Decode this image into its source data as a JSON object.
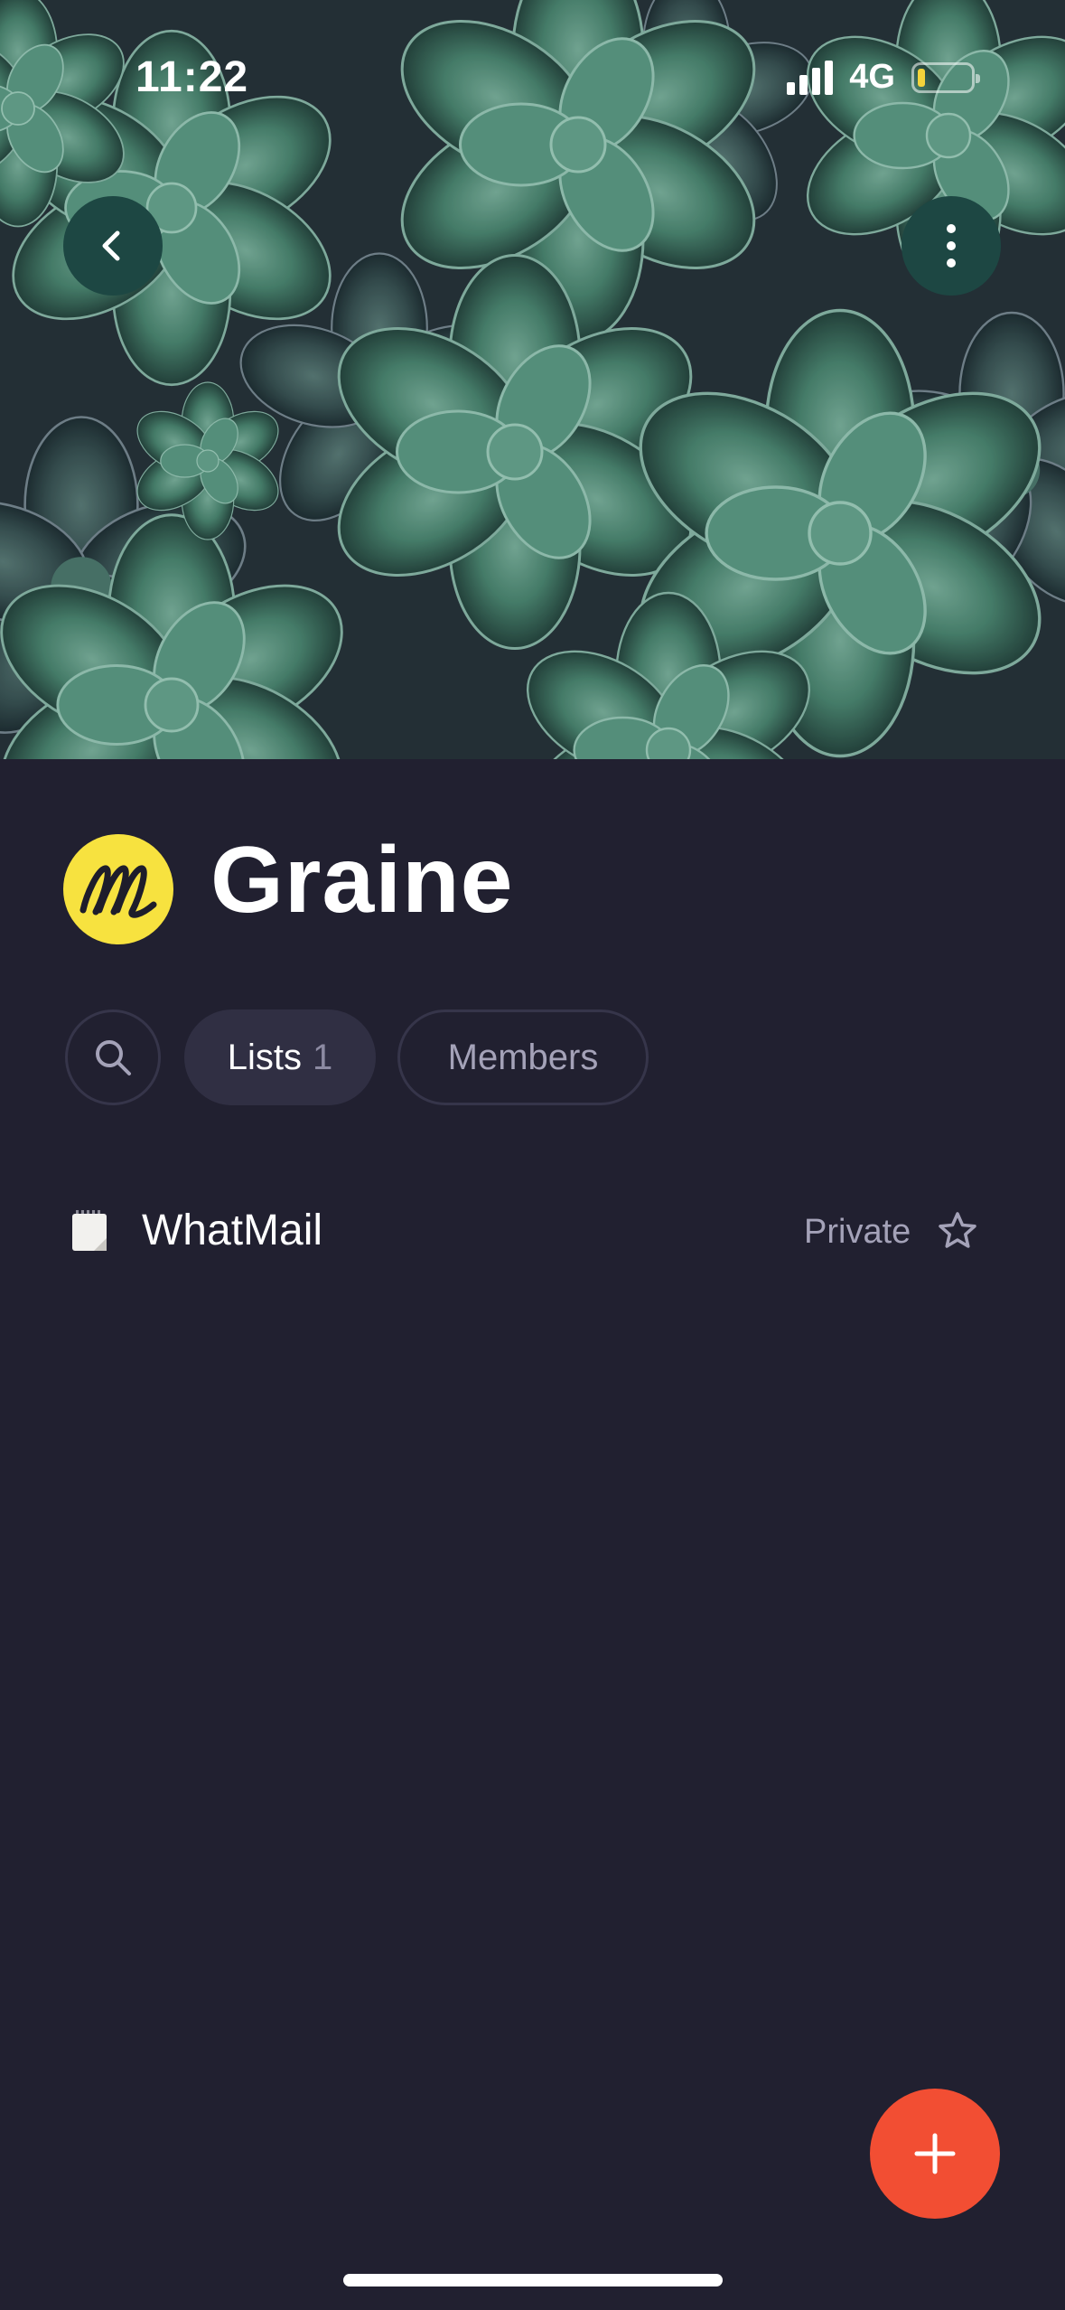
{
  "status_bar": {
    "time": "11:22",
    "network": "4G"
  },
  "cover": {
    "image": "succulent plants photo"
  },
  "header_buttons": {
    "back_icon": "chevron-left-icon",
    "more_icon": "more-vertical-icon"
  },
  "workspace": {
    "name": "Graine",
    "logo_color": "#f7e23f"
  },
  "tabs": {
    "search_icon": "search-icon",
    "lists_label": "Lists",
    "lists_count": "1",
    "members_label": "Members"
  },
  "lists": [
    {
      "name": "WhatMail",
      "icon": "notepad-icon",
      "privacy": "Private",
      "starred": false
    }
  ],
  "fab": {
    "icon": "plus-icon",
    "color": "#f24e33"
  },
  "colors": {
    "background": "#212030",
    "accent": "#f24e33",
    "header_button": "#1d4743"
  }
}
